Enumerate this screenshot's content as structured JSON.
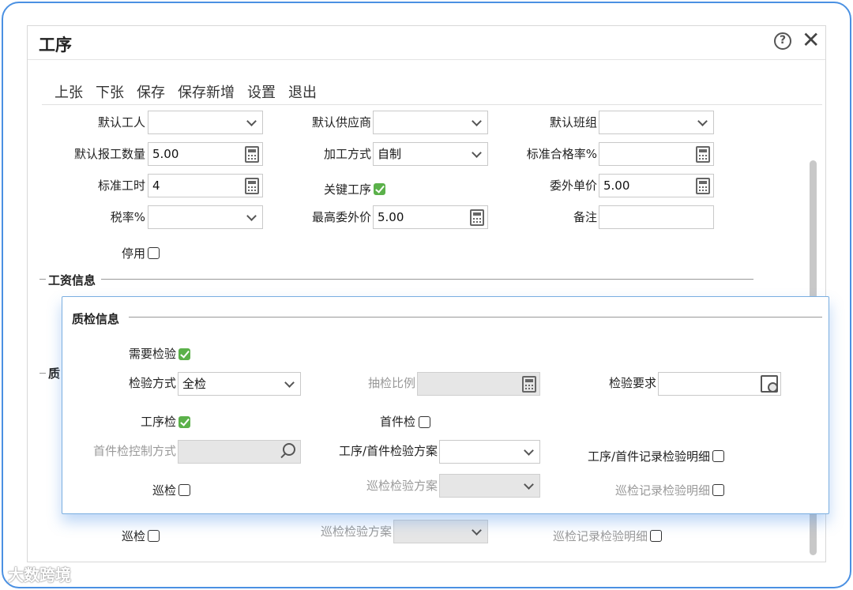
{
  "dialog": {
    "title": "工序",
    "help_icon": "help-circle-icon",
    "close_icon": "close-icon"
  },
  "toolbar": {
    "prev": "上张",
    "next": "下张",
    "save": "保存",
    "save_new": "保存新增",
    "settings": "设置",
    "exit": "退出"
  },
  "form": {
    "default_worker": {
      "label": "默认工人",
      "value": ""
    },
    "default_supplier": {
      "label": "默认供应商",
      "value": ""
    },
    "default_team": {
      "label": "默认班组",
      "value": ""
    },
    "default_report_qty": {
      "label": "默认报工数量",
      "value": "5.00"
    },
    "process_method": {
      "label": "加工方式",
      "value": "自制"
    },
    "std_pass_rate": {
      "label": "标准合格率%",
      "value": ""
    },
    "std_hours": {
      "label": "标准工时",
      "value": "4"
    },
    "key_process": {
      "label": "关键工序",
      "checked": true
    },
    "outsource_price": {
      "label": "委外单价",
      "value": "5.00"
    },
    "tax_rate": {
      "label": "税率%",
      "value": ""
    },
    "max_outsource_price": {
      "label": "最高委外价",
      "value": "5.00"
    },
    "remark": {
      "label": "备注",
      "value": ""
    },
    "disabled": {
      "label": "停用",
      "checked": false
    }
  },
  "sections": {
    "wage": "工资信息",
    "qc_partial": "质"
  },
  "background_patrol": {
    "patrol": {
      "label": "巡检",
      "checked": false
    },
    "patrol_plan": {
      "label": "巡检检验方案",
      "value": ""
    },
    "patrol_record_detail": {
      "label": "巡检记录检验明细",
      "checked": false
    }
  },
  "qc": {
    "title": "质检信息",
    "need_inspect": {
      "label": "需要检验",
      "checked": true
    },
    "inspect_method": {
      "label": "检验方式",
      "value": "全检"
    },
    "sample_ratio": {
      "label": "抽检比例",
      "value": ""
    },
    "inspect_req": {
      "label": "检验要求",
      "value": ""
    },
    "process_inspect": {
      "label": "工序检",
      "checked": true
    },
    "first_inspect": {
      "label": "首件检",
      "checked": false
    },
    "first_control": {
      "label": "首件检控制方式",
      "value": ""
    },
    "process_first_plan": {
      "label": "工序/首件检验方案",
      "value": ""
    },
    "process_first_record": {
      "label": "工序/首件记录检验明细",
      "checked": false
    },
    "patrol": {
      "label": "巡检",
      "checked": false
    },
    "patrol_plan": {
      "label": "巡检检验方案",
      "value": ""
    },
    "patrol_record": {
      "label": "巡检记录检验明细",
      "checked": false
    }
  },
  "watermark": "大数跨境",
  "colors": {
    "accent": "#4a90e2",
    "check": "#5bb14a"
  }
}
